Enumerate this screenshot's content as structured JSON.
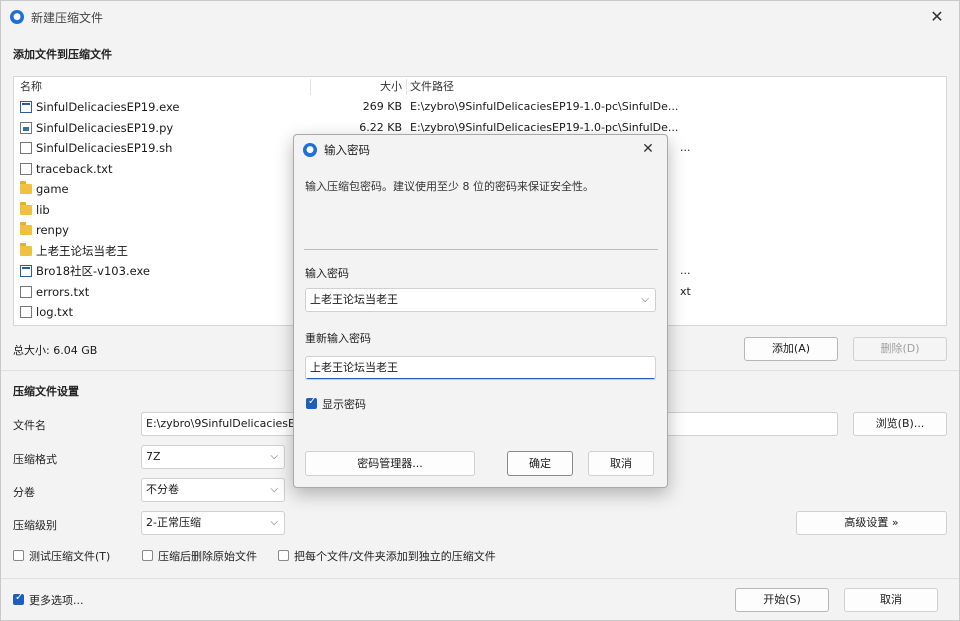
{
  "window": {
    "title": "新建压缩文件",
    "add_section_title": "添加文件到压缩文件"
  },
  "file_list": {
    "columns": {
      "name": "名称",
      "size": "大小",
      "path": "文件路径"
    },
    "rows": [
      {
        "icon": "exe-file-icon",
        "name": "SinfulDelicaciesEP19.exe",
        "size": "269 KB",
        "path": "E:\\zybro\\9SinfulDelicaciesEP19-1.0-pc\\SinfulDe...",
        "path_tail": ""
      },
      {
        "icon": "python-file-icon",
        "name": "SinfulDelicaciesEP19.py",
        "size": "6.22 KB",
        "path": "E:\\zybro\\9SinfulDelicaciesEP19-1.0-pc\\SinfulDe...",
        "path_tail": ""
      },
      {
        "icon": "document-icon",
        "name": "SinfulDelicaciesEP19.sh",
        "size": "",
        "path": "",
        "path_tail": "..."
      },
      {
        "icon": "document-icon",
        "name": "traceback.txt",
        "size": "",
        "path": "",
        "path_tail": ""
      },
      {
        "icon": "folder-icon",
        "name": "game",
        "size": "",
        "path": "",
        "path_tail": ""
      },
      {
        "icon": "folder-icon",
        "name": "lib",
        "size": "",
        "path": "",
        "path_tail": ""
      },
      {
        "icon": "folder-icon",
        "name": "renpy",
        "size": "",
        "path": "",
        "path_tail": ""
      },
      {
        "icon": "folder-icon",
        "name": "上老王论坛当老王",
        "size": "",
        "path": "",
        "path_tail": ""
      },
      {
        "icon": "exe-file-icon",
        "name": "Bro18社区-v103.exe",
        "size": "",
        "path": "",
        "path_tail": "..."
      },
      {
        "icon": "document-icon",
        "name": "errors.txt",
        "size": "",
        "path": "",
        "path_tail": "xt"
      },
      {
        "icon": "document-icon",
        "name": "log.txt",
        "size": "",
        "path": "",
        "path_tail": ""
      }
    ]
  },
  "total_size": "总大小: 6.04 GB",
  "buttons": {
    "add": "添加(A)",
    "delete": "删除(D)",
    "browse": "浏览(B)...",
    "advanced": "高级设置 »",
    "start": "开始(S)",
    "cancel": "取消"
  },
  "settings": {
    "section_title": "压缩文件设置",
    "filename_label": "文件名",
    "filename_value": "E:\\zybro\\9SinfulDelicaciesE",
    "format_label": "压缩格式",
    "format_value": "7Z",
    "split_label": "分卷",
    "split_value": "不分卷",
    "level_label": "压缩级别",
    "level_value": "2-正常压缩",
    "check_test": "测试压缩文件(T)",
    "check_delete": "压缩后删除原始文件",
    "check_separate": "把每个文件/文件夹添加到独立的压缩文件",
    "more_options": "更多选项..."
  },
  "dialog": {
    "title": "输入密码",
    "description": "输入压缩包密码。建议使用至少 8 位的密码来保证安全性。",
    "password_label": "输入密码",
    "password_value": "上老王论坛当老王",
    "reenter_label": "重新输入密码",
    "reenter_value": "上老王论坛当老王",
    "show_password": "显示密码",
    "manager_button": "密码管理器...",
    "ok_button": "确定",
    "cancel_button": "取消"
  },
  "colors": {
    "accent": "#1c5fbe",
    "folder": "#f0c040"
  }
}
